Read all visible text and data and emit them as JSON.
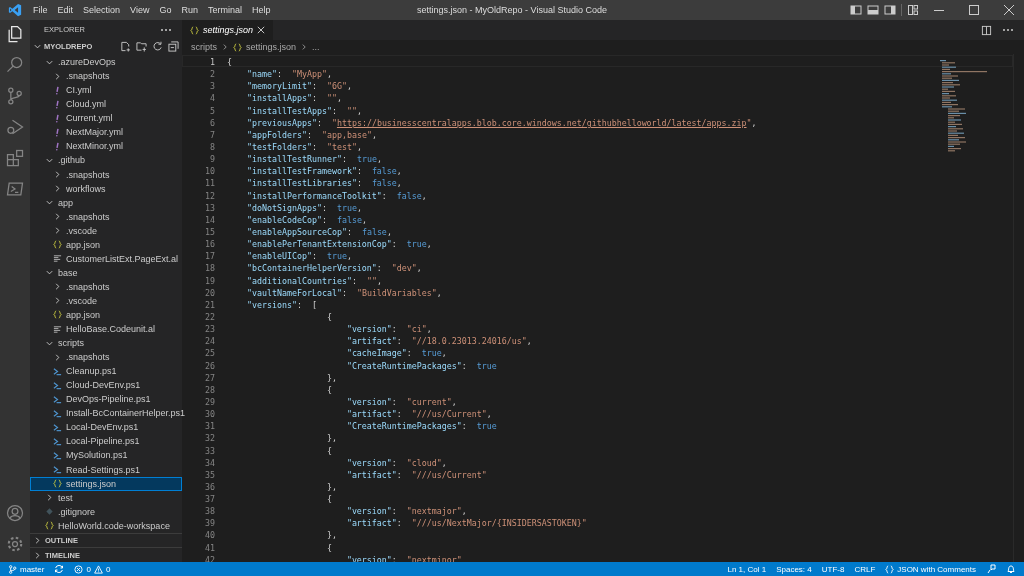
{
  "window": {
    "title": "settings.json - MyOldRepo - Visual Studio Code"
  },
  "menu": [
    "File",
    "Edit",
    "Selection",
    "View",
    "Go",
    "Run",
    "Terminal",
    "Help"
  ],
  "sidebar": {
    "title": "EXPLORER",
    "root": {
      "label": "MYOLDREPO",
      "expanded": true
    },
    "tree": [
      {
        "label": ".azureDevOps",
        "kind": "folder",
        "expanded": true,
        "selected": false,
        "children": [
          {
            "label": ".snapshots",
            "kind": "folder",
            "expanded": false,
            "selected": false
          },
          {
            "label": "CI.yml",
            "kind": "yaml",
            "selected": false
          },
          {
            "label": "Cloud.yml",
            "kind": "yaml",
            "selected": false
          },
          {
            "label": "Current.yml",
            "kind": "yaml",
            "selected": false
          },
          {
            "label": "NextMajor.yml",
            "kind": "yaml",
            "selected": false
          },
          {
            "label": "NextMinor.yml",
            "kind": "yaml",
            "selected": false
          }
        ]
      },
      {
        "label": ".github",
        "kind": "folder",
        "expanded": true,
        "selected": false,
        "children": [
          {
            "label": ".snapshots",
            "kind": "folder",
            "expanded": false,
            "selected": false
          },
          {
            "label": "workflows",
            "kind": "folder",
            "expanded": false,
            "selected": false
          }
        ]
      },
      {
        "label": "app",
        "kind": "folder",
        "expanded": true,
        "selected": false,
        "children": [
          {
            "label": ".snapshots",
            "kind": "folder",
            "expanded": false,
            "selected": false
          },
          {
            "label": ".vscode",
            "kind": "folder",
            "expanded": false,
            "selected": false
          },
          {
            "label": "app.json",
            "kind": "json",
            "selected": false
          },
          {
            "label": "CustomerListExt.PageExt.al",
            "kind": "al",
            "selected": false
          }
        ]
      },
      {
        "label": "base",
        "kind": "folder",
        "expanded": true,
        "selected": false,
        "children": [
          {
            "label": ".snapshots",
            "kind": "folder",
            "expanded": false,
            "selected": false
          },
          {
            "label": ".vscode",
            "kind": "folder",
            "expanded": false,
            "selected": false
          },
          {
            "label": "app.json",
            "kind": "json",
            "selected": false
          },
          {
            "label": "HelloBase.Codeunit.al",
            "kind": "al",
            "selected": false
          }
        ]
      },
      {
        "label": "scripts",
        "kind": "folder",
        "expanded": true,
        "selected": false,
        "children": [
          {
            "label": ".snapshots",
            "kind": "folder",
            "expanded": false,
            "selected": false
          },
          {
            "label": "Cleanup.ps1",
            "kind": "ps1",
            "selected": false
          },
          {
            "label": "Cloud-DevEnv.ps1",
            "kind": "ps1",
            "selected": false
          },
          {
            "label": "DevOps-Pipeline.ps1",
            "kind": "ps1",
            "selected": false
          },
          {
            "label": "Install-BcContainerHelper.ps1",
            "kind": "ps1",
            "selected": false
          },
          {
            "label": "Local-DevEnv.ps1",
            "kind": "ps1",
            "selected": false
          },
          {
            "label": "Local-Pipeline.ps1",
            "kind": "ps1",
            "selected": false
          },
          {
            "label": "MySolution.ps1",
            "kind": "ps1",
            "selected": false
          },
          {
            "label": "Read-Settings.ps1",
            "kind": "ps1",
            "selected": false
          },
          {
            "label": "settings.json",
            "kind": "json",
            "selected": true
          }
        ]
      },
      {
        "label": "test",
        "kind": "folder",
        "expanded": false,
        "selected": false
      },
      {
        "label": ".gitignore",
        "kind": "git",
        "selected": false
      },
      {
        "label": "HelloWorld.code-workspace",
        "kind": "json",
        "selected": false
      }
    ],
    "sections": [
      {
        "label": "OUTLINE",
        "expanded": false
      },
      {
        "label": "TIMELINE",
        "expanded": false
      }
    ]
  },
  "tabs": [
    {
      "label": "settings.json",
      "selected": true
    }
  ],
  "breadcrumb": {
    "folder": "scripts",
    "file": "settings.json",
    "more": "..."
  },
  "editor": {
    "lines": [
      {
        "number": "1",
        "current": true,
        "tokens": [
          {
            "kind": "punct",
            "text": "{"
          }
        ]
      },
      {
        "number": "2",
        "current": false,
        "tokens": [
          {
            "kind": "key",
            "text": "    \"name\""
          },
          {
            "kind": "punct",
            "text": ":  "
          },
          {
            "kind": "string",
            "text": "\"MyApp\""
          },
          {
            "kind": "punct",
            "text": ","
          }
        ]
      },
      {
        "number": "3",
        "current": false,
        "tokens": [
          {
            "kind": "key",
            "text": "    \"memoryLimit\""
          },
          {
            "kind": "punct",
            "text": ":  "
          },
          {
            "kind": "string",
            "text": "\"6G\""
          },
          {
            "kind": "punct",
            "text": ","
          }
        ]
      },
      {
        "number": "4",
        "current": false,
        "tokens": [
          {
            "kind": "key",
            "text": "    \"installApps\""
          },
          {
            "kind": "punct",
            "text": ":  "
          },
          {
            "kind": "string",
            "text": "\"\""
          },
          {
            "kind": "punct",
            "text": ","
          }
        ]
      },
      {
        "number": "5",
        "current": false,
        "tokens": [
          {
            "kind": "key",
            "text": "    \"installTestApps\""
          },
          {
            "kind": "punct",
            "text": ":  "
          },
          {
            "kind": "string",
            "text": "\"\""
          },
          {
            "kind": "punct",
            "text": ","
          }
        ]
      },
      {
        "number": "6",
        "current": false,
        "tokens": [
          {
            "kind": "key",
            "text": "    \"previousApps\""
          },
          {
            "kind": "punct",
            "text": ":  "
          },
          {
            "kind": "string",
            "text": "\""
          },
          {
            "kind": "link",
            "text": "https://businesscentralapps.blob.core.windows.net/githubhelloworld/latest/apps.zip"
          },
          {
            "kind": "string",
            "text": "\""
          },
          {
            "kind": "punct",
            "text": ","
          }
        ]
      },
      {
        "number": "7",
        "current": false,
        "tokens": [
          {
            "kind": "key",
            "text": "    \"appFolders\""
          },
          {
            "kind": "punct",
            "text": ":  "
          },
          {
            "kind": "string",
            "text": "\"app,base\""
          },
          {
            "kind": "punct",
            "text": ","
          }
        ]
      },
      {
        "number": "8",
        "current": false,
        "tokens": [
          {
            "kind": "key",
            "text": "    \"testFolders\""
          },
          {
            "kind": "punct",
            "text": ":  "
          },
          {
            "kind": "string",
            "text": "\"test\""
          },
          {
            "kind": "punct",
            "text": ","
          }
        ]
      },
      {
        "number": "9",
        "current": false,
        "tokens": [
          {
            "kind": "key",
            "text": "    \"installTestRunner\""
          },
          {
            "kind": "punct",
            "text": ":  "
          },
          {
            "kind": "bool",
            "text": "true"
          },
          {
            "kind": "punct",
            "text": ","
          }
        ]
      },
      {
        "number": "10",
        "current": false,
        "tokens": [
          {
            "kind": "key",
            "text": "    \"installTestFramework\""
          },
          {
            "kind": "punct",
            "text": ":  "
          },
          {
            "kind": "bool",
            "text": "false"
          },
          {
            "kind": "punct",
            "text": ","
          }
        ]
      },
      {
        "number": "11",
        "current": false,
        "tokens": [
          {
            "kind": "key",
            "text": "    \"installTestLibraries\""
          },
          {
            "kind": "punct",
            "text": ":  "
          },
          {
            "kind": "bool",
            "text": "false"
          },
          {
            "kind": "punct",
            "text": ","
          }
        ]
      },
      {
        "number": "12",
        "current": false,
        "tokens": [
          {
            "kind": "key",
            "text": "    \"installPerformanceToolkit\""
          },
          {
            "kind": "punct",
            "text": ":  "
          },
          {
            "kind": "bool",
            "text": "false"
          },
          {
            "kind": "punct",
            "text": ","
          }
        ]
      },
      {
        "number": "13",
        "current": false,
        "tokens": [
          {
            "kind": "key",
            "text": "    \"doNotSignApps\""
          },
          {
            "kind": "punct",
            "text": ":  "
          },
          {
            "kind": "bool",
            "text": "true"
          },
          {
            "kind": "punct",
            "text": ","
          }
        ]
      },
      {
        "number": "14",
        "current": false,
        "tokens": [
          {
            "kind": "key",
            "text": "    \"enableCodeCop\""
          },
          {
            "kind": "punct",
            "text": ":  "
          },
          {
            "kind": "bool",
            "text": "false"
          },
          {
            "kind": "punct",
            "text": ","
          }
        ]
      },
      {
        "number": "15",
        "current": false,
        "tokens": [
          {
            "kind": "key",
            "text": "    \"enableAppSourceCop\""
          },
          {
            "kind": "punct",
            "text": ":  "
          },
          {
            "kind": "bool",
            "text": "false"
          },
          {
            "kind": "punct",
            "text": ","
          }
        ]
      },
      {
        "number": "16",
        "current": false,
        "tokens": [
          {
            "kind": "key",
            "text": "    \"enablePerTenantExtensionCop\""
          },
          {
            "kind": "punct",
            "text": ":  "
          },
          {
            "kind": "bool",
            "text": "true"
          },
          {
            "kind": "punct",
            "text": ","
          }
        ]
      },
      {
        "number": "17",
        "current": false,
        "tokens": [
          {
            "kind": "key",
            "text": "    \"enableUICop\""
          },
          {
            "kind": "punct",
            "text": ":  "
          },
          {
            "kind": "bool",
            "text": "true"
          },
          {
            "kind": "punct",
            "text": ","
          }
        ]
      },
      {
        "number": "18",
        "current": false,
        "tokens": [
          {
            "kind": "key",
            "text": "    \"bcContainerHelperVersion\""
          },
          {
            "kind": "punct",
            "text": ":  "
          },
          {
            "kind": "string",
            "text": "\"dev\""
          },
          {
            "kind": "punct",
            "text": ","
          }
        ]
      },
      {
        "number": "19",
        "current": false,
        "tokens": [
          {
            "kind": "key",
            "text": "    \"additionalCountries\""
          },
          {
            "kind": "punct",
            "text": ":  "
          },
          {
            "kind": "string",
            "text": "\"\""
          },
          {
            "kind": "punct",
            "text": ","
          }
        ]
      },
      {
        "number": "20",
        "current": false,
        "tokens": [
          {
            "kind": "key",
            "text": "    \"vaultNameForLocal\""
          },
          {
            "kind": "punct",
            "text": ":  "
          },
          {
            "kind": "string",
            "text": "\"BuildVariables\""
          },
          {
            "kind": "punct",
            "text": ","
          }
        ]
      },
      {
        "number": "21",
        "current": false,
        "tokens": [
          {
            "kind": "key",
            "text": "    \"versions\""
          },
          {
            "kind": "punct",
            "text": ":  ["
          }
        ]
      },
      {
        "number": "22",
        "current": false,
        "tokens": [
          {
            "kind": "punct",
            "text": "                    {"
          }
        ]
      },
      {
        "number": "23",
        "current": false,
        "tokens": [
          {
            "kind": "key",
            "text": "                        \"version\""
          },
          {
            "kind": "punct",
            "text": ":  "
          },
          {
            "kind": "string",
            "text": "\"ci\""
          },
          {
            "kind": "punct",
            "text": ","
          }
        ]
      },
      {
        "number": "24",
        "current": false,
        "tokens": [
          {
            "kind": "key",
            "text": "                        \"artifact\""
          },
          {
            "kind": "punct",
            "text": ":  "
          },
          {
            "kind": "string",
            "text": "\"//18.0.23013.24016/us\""
          },
          {
            "kind": "punct",
            "text": ","
          }
        ]
      },
      {
        "number": "25",
        "current": false,
        "tokens": [
          {
            "kind": "key",
            "text": "                        \"cacheImage\""
          },
          {
            "kind": "punct",
            "text": ":  "
          },
          {
            "kind": "bool",
            "text": "true"
          },
          {
            "kind": "punct",
            "text": ","
          }
        ]
      },
      {
        "number": "26",
        "current": false,
        "tokens": [
          {
            "kind": "key",
            "text": "                        \"CreateRuntimePackages\""
          },
          {
            "kind": "punct",
            "text": ":  "
          },
          {
            "kind": "bool",
            "text": "true"
          }
        ]
      },
      {
        "number": "27",
        "current": false,
        "tokens": [
          {
            "kind": "punct",
            "text": "                    },"
          }
        ]
      },
      {
        "number": "28",
        "current": false,
        "tokens": [
          {
            "kind": "punct",
            "text": "                    {"
          }
        ]
      },
      {
        "number": "29",
        "current": false,
        "tokens": [
          {
            "kind": "key",
            "text": "                        \"version\""
          },
          {
            "kind": "punct",
            "text": ":  "
          },
          {
            "kind": "string",
            "text": "\"current\""
          },
          {
            "kind": "punct",
            "text": ","
          }
        ]
      },
      {
        "number": "30",
        "current": false,
        "tokens": [
          {
            "kind": "key",
            "text": "                        \"artifact\""
          },
          {
            "kind": "punct",
            "text": ":  "
          },
          {
            "kind": "string",
            "text": "\"///us/Current\""
          },
          {
            "kind": "punct",
            "text": ","
          }
        ]
      },
      {
        "number": "31",
        "current": false,
        "tokens": [
          {
            "kind": "key",
            "text": "                        \"CreateRuntimePackages\""
          },
          {
            "kind": "punct",
            "text": ":  "
          },
          {
            "kind": "bool",
            "text": "true"
          }
        ]
      },
      {
        "number": "32",
        "current": false,
        "tokens": [
          {
            "kind": "punct",
            "text": "                    },"
          }
        ]
      },
      {
        "number": "33",
        "current": false,
        "tokens": [
          {
            "kind": "punct",
            "text": "                    {"
          }
        ]
      },
      {
        "number": "34",
        "current": false,
        "tokens": [
          {
            "kind": "key",
            "text": "                        \"version\""
          },
          {
            "kind": "punct",
            "text": ":  "
          },
          {
            "kind": "string",
            "text": "\"cloud\""
          },
          {
            "kind": "punct",
            "text": ","
          }
        ]
      },
      {
        "number": "35",
        "current": false,
        "tokens": [
          {
            "kind": "key",
            "text": "                        \"artifact\""
          },
          {
            "kind": "punct",
            "text": ":  "
          },
          {
            "kind": "string",
            "text": "\"///us/Current\""
          }
        ]
      },
      {
        "number": "36",
        "current": false,
        "tokens": [
          {
            "kind": "punct",
            "text": "                    },"
          }
        ]
      },
      {
        "number": "37",
        "current": false,
        "tokens": [
          {
            "kind": "punct",
            "text": "                    {"
          }
        ]
      },
      {
        "number": "38",
        "current": false,
        "tokens": [
          {
            "kind": "key",
            "text": "                        \"version\""
          },
          {
            "kind": "punct",
            "text": ":  "
          },
          {
            "kind": "string",
            "text": "\"nextmajor\""
          },
          {
            "kind": "punct",
            "text": ","
          }
        ]
      },
      {
        "number": "39",
        "current": false,
        "tokens": [
          {
            "kind": "key",
            "text": "                        \"artifact\""
          },
          {
            "kind": "punct",
            "text": ":  "
          },
          {
            "kind": "string",
            "text": "\"///us/NextMajor/{INSIDERSASTOKEN}\""
          }
        ]
      },
      {
        "number": "40",
        "current": false,
        "tokens": [
          {
            "kind": "punct",
            "text": "                    },"
          }
        ]
      },
      {
        "number": "41",
        "current": false,
        "tokens": [
          {
            "kind": "punct",
            "text": "                    {"
          }
        ]
      },
      {
        "number": "42",
        "current": false,
        "tokens": [
          {
            "kind": "key",
            "text": "                        \"version\""
          },
          {
            "kind": "punct",
            "text": ":  "
          },
          {
            "kind": "string",
            "text": "\"nextminor\""
          }
        ]
      }
    ]
  },
  "status_bar": {
    "branch": "master",
    "errors": "0",
    "warnings": "0",
    "position": "Ln 1, Col 1",
    "spaces": "Spaces: 4",
    "encoding": "UTF-8",
    "eol": "CRLF",
    "language": "JSON with Comments"
  }
}
